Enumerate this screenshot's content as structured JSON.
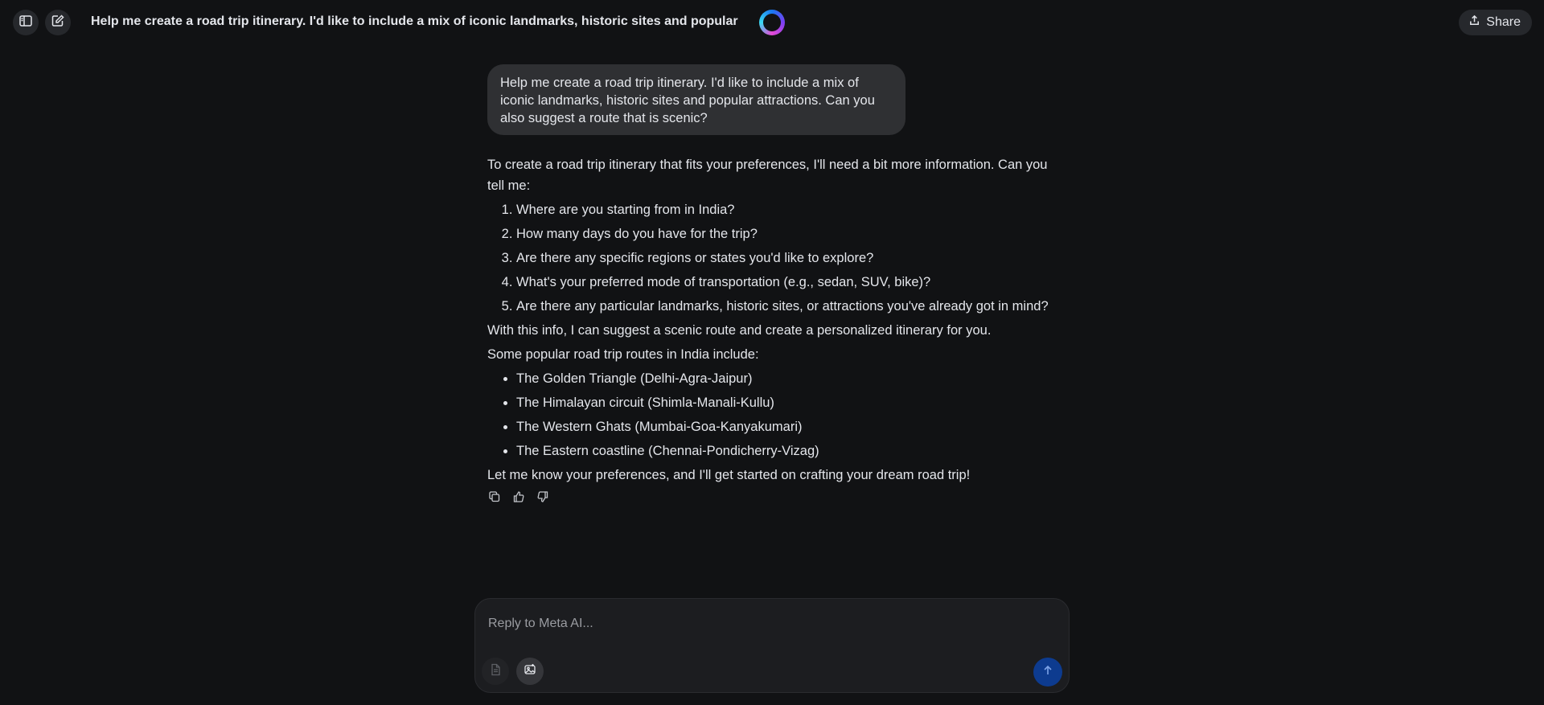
{
  "header": {
    "title": "Help me create a road trip itinerary. I'd like to include a mix of iconic landmarks, historic sites and popular attra...",
    "share_label": "Share",
    "icons": [
      "sidebar-toggle-icon",
      "new-chat-icon",
      "meta-ai-logo",
      "share-icon"
    ]
  },
  "user_message": "Help me create a road trip itinerary. I'd like to include a mix of iconic landmarks, historic sites and popular attractions. Can you also suggest a route that is scenic?",
  "assistant": {
    "intro": "To create a road trip itinerary that fits your preferences, I'll need a bit more information. Can you tell me:",
    "questions": [
      "Where are you starting from in India?",
      "How many days do you have for the trip?",
      "Are there any specific regions or states you'd like to explore?",
      "What's your preferred mode of transportation (e.g., sedan, SUV, bike)?",
      "Are there any particular landmarks, historic sites, or attractions you've already got in mind?"
    ],
    "followup": "With this info, I can suggest a scenic route and create a personalized itinerary for you.",
    "routes_intro": "Some popular road trip routes in India include:",
    "routes": [
      "The Golden Triangle (Delhi-Agra-Jaipur)",
      "The Himalayan circuit (Shimla-Manali-Kullu)",
      "The Western Ghats (Mumbai-Goa-Kanyakumari)",
      "The Eastern coastline (Chennai-Pondicherry-Vizag)"
    ],
    "closing": "Let me know your preferences, and I'll get started on crafting your dream road trip!",
    "reactions": [
      "copy-icon",
      "thumbs-up-icon",
      "thumbs-down-icon"
    ]
  },
  "composer": {
    "placeholder": "Reply to Meta AI...",
    "value": "",
    "tools": [
      "attach-document-icon",
      "image-generate-icon"
    ],
    "send_icon": "arrow-up-icon"
  },
  "colors": {
    "background": "#111214",
    "bubble": "#2f3033",
    "composer": "#1c1d20",
    "send_button": "#0d3b8f"
  }
}
